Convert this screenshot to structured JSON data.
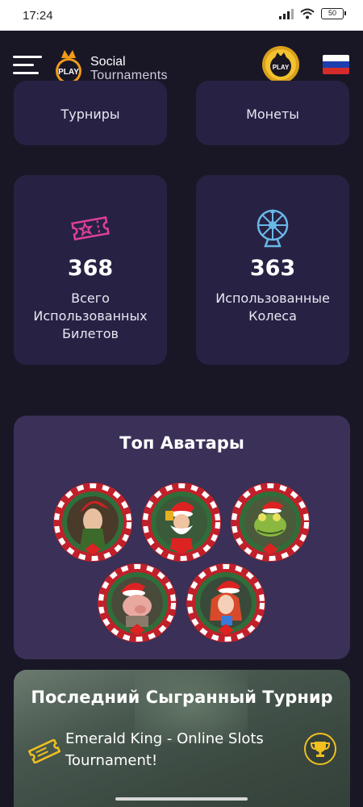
{
  "status_bar": {
    "time": "17:24",
    "battery": "50"
  },
  "header": {
    "brand_line1": "Social",
    "brand_line2": "Tournaments",
    "logo_text": "PLAY",
    "coin_text": "PLAY"
  },
  "top_cards": [
    {
      "label": "Турниры"
    },
    {
      "label": "Монеты"
    }
  ],
  "stats": [
    {
      "icon": "ticket-icon",
      "value": "368",
      "label": "Всего Использованных Билетов"
    },
    {
      "icon": "wheel-icon",
      "value": "363",
      "label": "Использованные Колеса"
    }
  ],
  "top_avatars": {
    "title": "Топ Аватары",
    "items": [
      {
        "name": "elf-woman-avatar"
      },
      {
        "name": "santa-avatar"
      },
      {
        "name": "frog-avatar"
      },
      {
        "name": "pig-avatar"
      },
      {
        "name": "redhead-girl-avatar"
      }
    ]
  },
  "last_tournament": {
    "title": "Последний Сыгранный Турнир",
    "name": "Emerald King - Online Slots Tournament!"
  },
  "colors": {
    "background": "#191726",
    "card": "#272244",
    "avatars_card": "#3a3058",
    "ticket_pink": "#e0409a",
    "wheel_blue": "#6ab8e8",
    "gold": "#f0c020"
  }
}
